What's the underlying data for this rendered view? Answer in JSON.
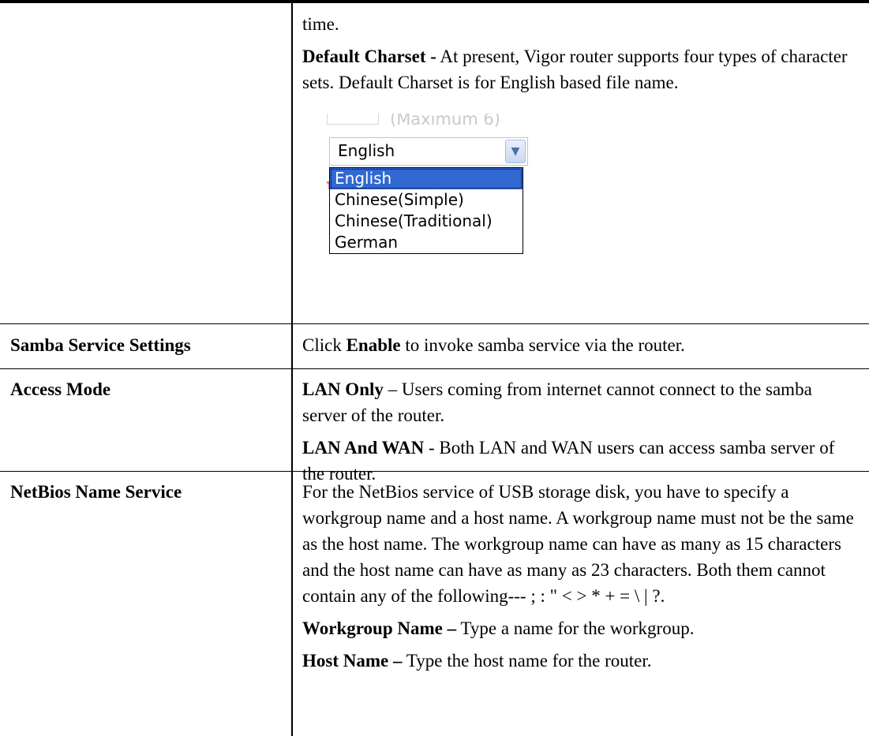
{
  "top_cell": {
    "time_text": "time.",
    "charset_term": "Default Charset -",
    "charset_desc": " At present, Vigor router supports four types of character sets. Default Charset is for English based file name."
  },
  "screenshot": {
    "ghost_text": "(Maximum 6)",
    "select_value": "English",
    "options": [
      "English",
      "Chinese(Simple)",
      "Chinese(Traditional)",
      "German"
    ],
    "selected_index": 0
  },
  "rows": {
    "samba": {
      "label": "Samba Service Settings",
      "pre": "Click ",
      "term": "Enable",
      "post": " to invoke samba service via the router."
    },
    "access": {
      "label": "Access Mode",
      "lan_only_term": "LAN Only",
      "lan_only_desc": " – Users coming from internet cannot connect to the samba server of the router.",
      "lan_wan_term": "LAN And WAN",
      "lan_wan_desc": " - Both LAN and WAN users can access samba server of the router."
    },
    "netbios": {
      "label": "NetBios Name Service",
      "desc": "For the NetBios service of USB storage disk, you have to specify a workgroup name and a host name. A workgroup name must not be the same as the host name. The workgroup name can have as many as 15 characters and the host name can have as many as 23 characters. Both them cannot contain any of the following--- ; : \" < > * + = \\ | ?.",
      "workgroup_term": "Workgroup Name –",
      "workgroup_desc": " Type a name for the workgroup.",
      "host_term": "Host Name –",
      "host_desc": " Type the host name for the router."
    }
  }
}
